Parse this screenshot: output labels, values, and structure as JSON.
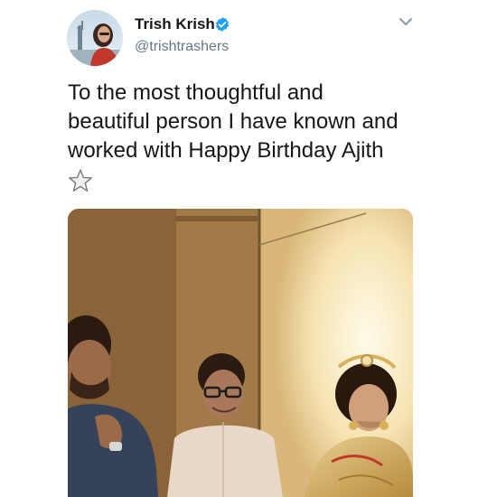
{
  "tweet": {
    "author": {
      "display_name": "Trish Krish",
      "handle": "@trishtrashers",
      "verified": true
    },
    "text_lines": [
      "To the most thoughtful and",
      "beautiful person I have known and",
      "worked with Happy Birthday Ajith"
    ],
    "emoji": "star-outline",
    "media": {
      "type": "photo"
    },
    "colors": {
      "verified_badge": "#1da1f2",
      "text": "#14171a",
      "secondary_text": "#657786"
    }
  }
}
